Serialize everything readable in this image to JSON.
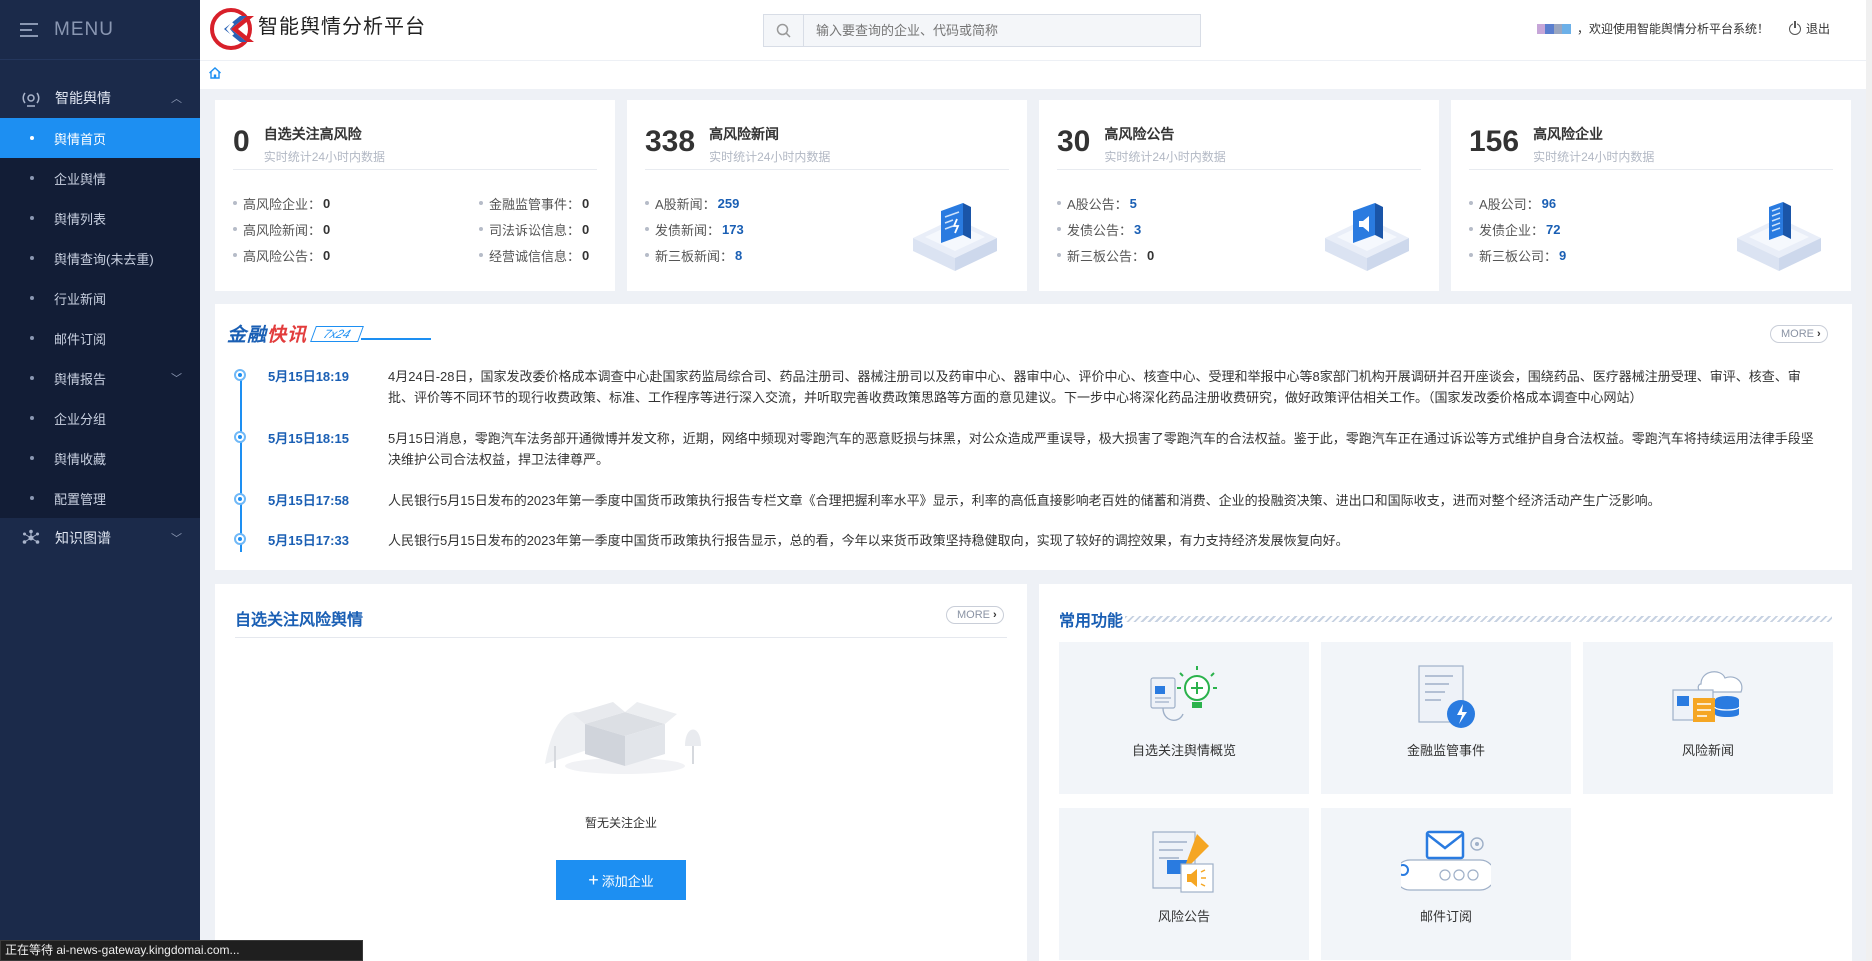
{
  "sidebar": {
    "menu_label": "MENU",
    "groups": [
      {
        "label": "智能舆情",
        "icon": "radar-icon",
        "items": [
          {
            "label": "舆情首页",
            "active": true
          },
          {
            "label": "企业舆情"
          },
          {
            "label": "舆情列表"
          },
          {
            "label": "舆情查询(未去重)"
          },
          {
            "label": "行业新闻"
          },
          {
            "label": "邮件订阅"
          },
          {
            "label": "舆情报告"
          },
          {
            "label": "企业分组"
          },
          {
            "label": "舆情收藏"
          },
          {
            "label": "配置管理"
          }
        ]
      },
      {
        "label": "知识图谱",
        "icon": "graph-icon"
      }
    ]
  },
  "header": {
    "logo_title": "智能舆情分析平台",
    "search_placeholder": "输入要查询的企业、代码或简称",
    "welcome": "，欢迎使用智能舆情分析平台系统！",
    "logout": "退出"
  },
  "stats": [
    {
      "number": "0",
      "title": "自选关注高风险",
      "subtitle": "实时统计24小时内数据",
      "col1": [
        {
          "label": "高风险企业：",
          "value": "0"
        },
        {
          "label": "高风险新闻：",
          "value": "0"
        },
        {
          "label": "高风险公告：",
          "value": "0"
        }
      ],
      "col2": [
        {
          "label": "金融监管事件：",
          "value": "0"
        },
        {
          "label": "司法诉讼信息：",
          "value": "0"
        },
        {
          "label": "经营诚信信息：",
          "value": "0"
        }
      ]
    },
    {
      "number": "338",
      "title": "高风险新闻",
      "subtitle": "实时统计24小时内数据",
      "rows": [
        {
          "label": "A股新闻：",
          "value": "259"
        },
        {
          "label": "发债新闻：",
          "value": "173"
        },
        {
          "label": "新三板新闻：",
          "value": "8"
        }
      ]
    },
    {
      "number": "30",
      "title": "高风险公告",
      "subtitle": "实时统计24小时内数据",
      "rows": [
        {
          "label": "A股公告：",
          "value": "5"
        },
        {
          "label": "发债公告：",
          "value": "3"
        },
        {
          "label": "新三板公告：",
          "value": "0"
        }
      ]
    },
    {
      "number": "156",
      "title": "高风险企业",
      "subtitle": "实时统计24小时内数据",
      "rows": [
        {
          "label": "A股公司：",
          "value": "96"
        },
        {
          "label": "发债企业：",
          "value": "72"
        },
        {
          "label": "新三板公司：",
          "value": "9"
        }
      ]
    }
  ],
  "flash": {
    "title_a": "金融",
    "title_b": "快讯",
    "tag": "7x24",
    "more": "MORE",
    "items": [
      {
        "time": "5月15日18:19",
        "text": "4月24日-28日，国家发改委价格成本调查中心赴国家药监局综合司、药品注册司、器械注册司以及药审中心、器审中心、评价中心、核查中心、受理和举报中心等8家部门机构开展调研并召开座谈会，围绕药品、医疗器械注册受理、审评、核查、审批、评价等不同环节的现行收费政策、标准、工作程序等进行深入交流，并听取完善收费政策思路等方面的意见建议。下一步中心将深化药品注册收费研究，做好政策评估相关工作。（国家发改委价格成本调查中心网站）"
      },
      {
        "time": "5月15日18:15",
        "text": "5月15日消息，零跑汽车法务部开通微博并发文称，近期，网络中频现对零跑汽车的恶意贬损与抹黑，对公众造成严重误导，极大损害了零跑汽车的合法权益。鉴于此，零跑汽车正在通过诉讼等方式维护自身合法权益。零跑汽车将持续运用法律手段坚决维护公司合法权益，捍卫法律尊严。"
      },
      {
        "time": "5月15日17:58",
        "text": "人民银行5月15日发布的2023年第一季度中国货币政策执行报告专栏文章《合理把握利率水平》显示，利率的高低直接影响老百姓的储蓄和消费、企业的投融资决策、进出口和国际收支，进而对整个经济活动产生广泛影响。"
      },
      {
        "time": "5月15日17:33",
        "text": "人民银行5月15日发布的2023年第一季度中国货币政策执行报告显示，总的看，今年以来货币政策坚持稳健取向，实现了较好的调控效果，有力支持经济发展恢复向好。"
      }
    ]
  },
  "watch": {
    "title": "自选关注风险舆情",
    "more": "MORE",
    "empty_text": "暂无关注企业",
    "add_button": "添加企业"
  },
  "funcs": {
    "title": "常用功能",
    "tiles": [
      {
        "label": "自选关注舆情概览",
        "icon": "watch-overview-icon"
      },
      {
        "label": "金融监管事件",
        "icon": "regulation-event-icon"
      },
      {
        "label": "风险新闻",
        "icon": "risk-news-icon"
      },
      {
        "label": "风险公告",
        "icon": "risk-announcement-icon"
      },
      {
        "label": "邮件订阅",
        "icon": "mail-subscribe-icon"
      }
    ]
  },
  "status_text": "正在等待 ai-news-gateway.kingdomai.com..."
}
